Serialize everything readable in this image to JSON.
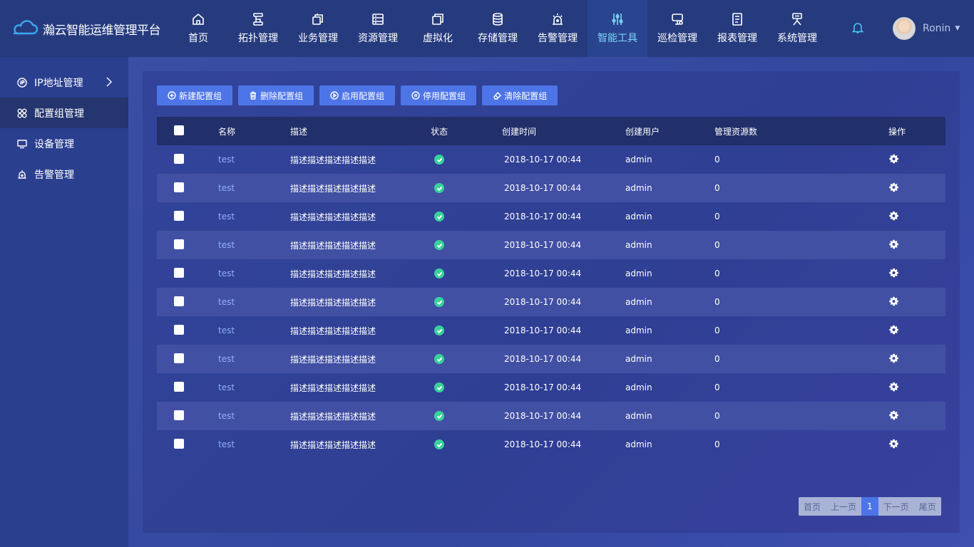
{
  "app": {
    "title": "瀚云智能运维管理平台"
  },
  "nav": [
    {
      "label": "首页",
      "icon": "home-icon"
    },
    {
      "label": "拓扑管理",
      "icon": "topology-icon"
    },
    {
      "label": "业务管理",
      "icon": "business-icon"
    },
    {
      "label": "资源管理",
      "icon": "resource-icon"
    },
    {
      "label": "虚拟化",
      "icon": "virtualization-icon"
    },
    {
      "label": "存储管理",
      "icon": "database-icon"
    },
    {
      "label": "告警管理",
      "icon": "alarm-icon"
    },
    {
      "label": "智能工具",
      "icon": "tools-icon",
      "active": true
    },
    {
      "label": "巡检管理",
      "icon": "inspection-icon"
    },
    {
      "label": "报表管理",
      "icon": "report-icon"
    },
    {
      "label": "系统管理",
      "icon": "system-icon"
    }
  ],
  "user": {
    "name": "Ronin"
  },
  "sidebar": [
    {
      "label": "IP地址管理",
      "icon": "ip-icon"
    },
    {
      "label": "配置组管理",
      "icon": "config-group-icon",
      "active": true
    },
    {
      "label": "设备管理",
      "icon": "monitor-icon"
    },
    {
      "label": "告警管理",
      "icon": "alarm-icon"
    }
  ],
  "toolbar": {
    "new_label": "新建配置组",
    "delete_label": "删除配置组",
    "enable_label": "启用配置组",
    "disable_label": "停用配置组",
    "clear_label": "清除配置组"
  },
  "table": {
    "headers": {
      "name": "名称",
      "desc": "描述",
      "status": "状态",
      "time": "创建时间",
      "user": "创建用户",
      "count": "管理资源数",
      "op": "操作"
    },
    "rows": [
      {
        "name": "test",
        "desc": "描述描述描述描述描述",
        "status": "enabled",
        "time": "2018-10-17 00:44",
        "user": "admin",
        "count": "0"
      },
      {
        "name": "test",
        "desc": "描述描述描述描述描述",
        "status": "enabled",
        "time": "2018-10-17 00:44",
        "user": "admin",
        "count": "0"
      },
      {
        "name": "test",
        "desc": "描述描述描述描述描述",
        "status": "enabled",
        "time": "2018-10-17 00:44",
        "user": "admin",
        "count": "0"
      },
      {
        "name": "test",
        "desc": "描述描述描述描述描述",
        "status": "enabled",
        "time": "2018-10-17 00:44",
        "user": "admin",
        "count": "0"
      },
      {
        "name": "test",
        "desc": "描述描述描述描述描述",
        "status": "enabled",
        "time": "2018-10-17 00:44",
        "user": "admin",
        "count": "0"
      },
      {
        "name": "test",
        "desc": "描述描述描述描述描述",
        "status": "enabled",
        "time": "2018-10-17 00:44",
        "user": "admin",
        "count": "0"
      },
      {
        "name": "test",
        "desc": "描述描述描述描述描述",
        "status": "enabled",
        "time": "2018-10-17 00:44",
        "user": "admin",
        "count": "0"
      },
      {
        "name": "test",
        "desc": "描述描述描述描述描述",
        "status": "enabled",
        "time": "2018-10-17 00:44",
        "user": "admin",
        "count": "0"
      },
      {
        "name": "test",
        "desc": "描述描述描述描述描述",
        "status": "enabled",
        "time": "2018-10-17 00:44",
        "user": "admin",
        "count": "0"
      },
      {
        "name": "test",
        "desc": "描述描述描述描述描述",
        "status": "enabled",
        "time": "2018-10-17 00:44",
        "user": "admin",
        "count": "0"
      },
      {
        "name": "test",
        "desc": "描述描述描述描述描述",
        "status": "enabled",
        "time": "2018-10-17 00:44",
        "user": "admin",
        "count": "0"
      }
    ]
  },
  "pagination": {
    "first": "首页",
    "prev": "上一页",
    "current": "1",
    "next": "下一页",
    "last": "尾页"
  },
  "colors": {
    "header": "#263b7e",
    "sidebar": "#2b3f8f",
    "button": "#4d75e8",
    "status_ok": "#36d39a",
    "accent": "#7dd3f5"
  }
}
